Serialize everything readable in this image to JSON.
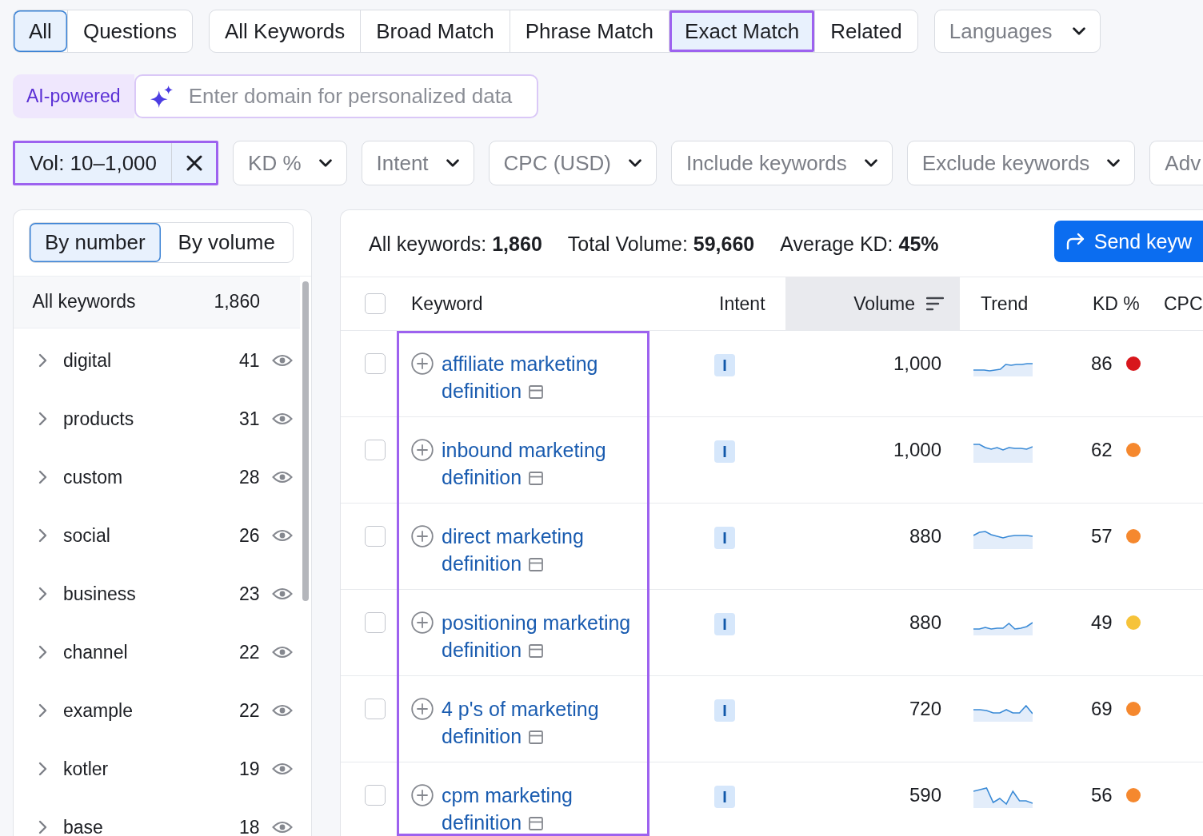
{
  "match_tabs": [
    {
      "items": [
        {
          "label": "All",
          "selected": true,
          "highlighted": false
        },
        {
          "label": "Questions",
          "selected": false,
          "highlighted": false
        }
      ]
    },
    {
      "items": [
        {
          "label": "All Keywords",
          "selected": false,
          "highlighted": false
        },
        {
          "label": "Broad Match",
          "selected": false,
          "highlighted": false
        },
        {
          "label": "Phrase Match",
          "selected": false,
          "highlighted": false
        },
        {
          "label": "Exact Match",
          "selected": true,
          "highlighted": true
        },
        {
          "label": "Related",
          "selected": false,
          "highlighted": false
        }
      ]
    }
  ],
  "language_select": {
    "label": "Languages"
  },
  "ai_search": {
    "badge": "AI-powered",
    "placeholder": "Enter domain for personalized data"
  },
  "filters": [
    {
      "kind": "applied",
      "label": "Vol: 10–1,000",
      "highlighted": true
    },
    {
      "kind": "dropdown",
      "label": "KD %",
      "highlighted": false
    },
    {
      "kind": "dropdown",
      "label": "Intent",
      "highlighted": false
    },
    {
      "kind": "dropdown",
      "label": "CPC (USD)",
      "highlighted": false
    },
    {
      "kind": "dropdown",
      "label": "Include keywords",
      "highlighted": false
    },
    {
      "kind": "dropdown",
      "label": "Exclude keywords",
      "highlighted": false
    },
    {
      "kind": "partial",
      "label": "Adv",
      "highlighted": false
    }
  ],
  "groups_panel": {
    "modes": [
      {
        "label": "By number",
        "selected": true
      },
      {
        "label": "By volume",
        "selected": false
      }
    ],
    "total": {
      "label": "All keywords",
      "count": "1,860"
    },
    "groups": [
      {
        "name": "digital",
        "count": "41",
        "expanded": false
      },
      {
        "name": "products",
        "count": "31",
        "expanded": false
      },
      {
        "name": "custom",
        "count": "28",
        "expanded": false
      },
      {
        "name": "social",
        "count": "26",
        "expanded": false
      },
      {
        "name": "business",
        "count": "23",
        "expanded": false
      },
      {
        "name": "channel",
        "count": "22",
        "expanded": false
      },
      {
        "name": "example",
        "count": "22",
        "expanded": false
      },
      {
        "name": "kotler",
        "count": "19",
        "expanded": false
      },
      {
        "name": "base",
        "count": "18",
        "expanded": false
      }
    ]
  },
  "results": {
    "summary": [
      "All keywords: **1,860**",
      "Total Volume: **59,660**",
      "Average KD: **45%**"
    ],
    "send_button": "Send keyw",
    "select_all_checked": false,
    "columns": [
      {
        "label": "Keyword",
        "sorted": false,
        "highlighted": true
      },
      {
        "label": "Intent",
        "sorted": false,
        "highlighted": false
      },
      {
        "label": "Volume",
        "sorted": true,
        "highlighted": false
      },
      {
        "label": "Trend",
        "sorted": false,
        "highlighted": false
      },
      {
        "label": "KD %",
        "sorted": false,
        "highlighted": false
      },
      {
        "label": "CPC",
        "sorted": false,
        "highlighted": false
      }
    ],
    "rows": [
      {
        "checked": false,
        "keyword": "affiliate marketing definition",
        "intent": "I",
        "volume": "1,000",
        "kd": "86",
        "color": "#d8161c"
      },
      {
        "checked": false,
        "keyword": "inbound marketing definition",
        "intent": "I",
        "volume": "1,000",
        "kd": "62",
        "color": "#f5882e"
      },
      {
        "checked": false,
        "keyword": "direct marketing definition",
        "intent": "I",
        "volume": "880",
        "kd": "57",
        "color": "#f5882e"
      },
      {
        "checked": false,
        "keyword": "positioning marketing definition",
        "intent": "I",
        "volume": "880",
        "kd": "49",
        "color": "#f6c339"
      },
      {
        "checked": false,
        "keyword": "4 p's of marketing definition",
        "intent": "I",
        "volume": "720",
        "kd": "69",
        "color": "#f5882e"
      },
      {
        "checked": false,
        "keyword": "cpm marketing definition",
        "intent": "I",
        "volume": "590",
        "kd": "56",
        "color": "#f5882e"
      }
    ]
  }
}
